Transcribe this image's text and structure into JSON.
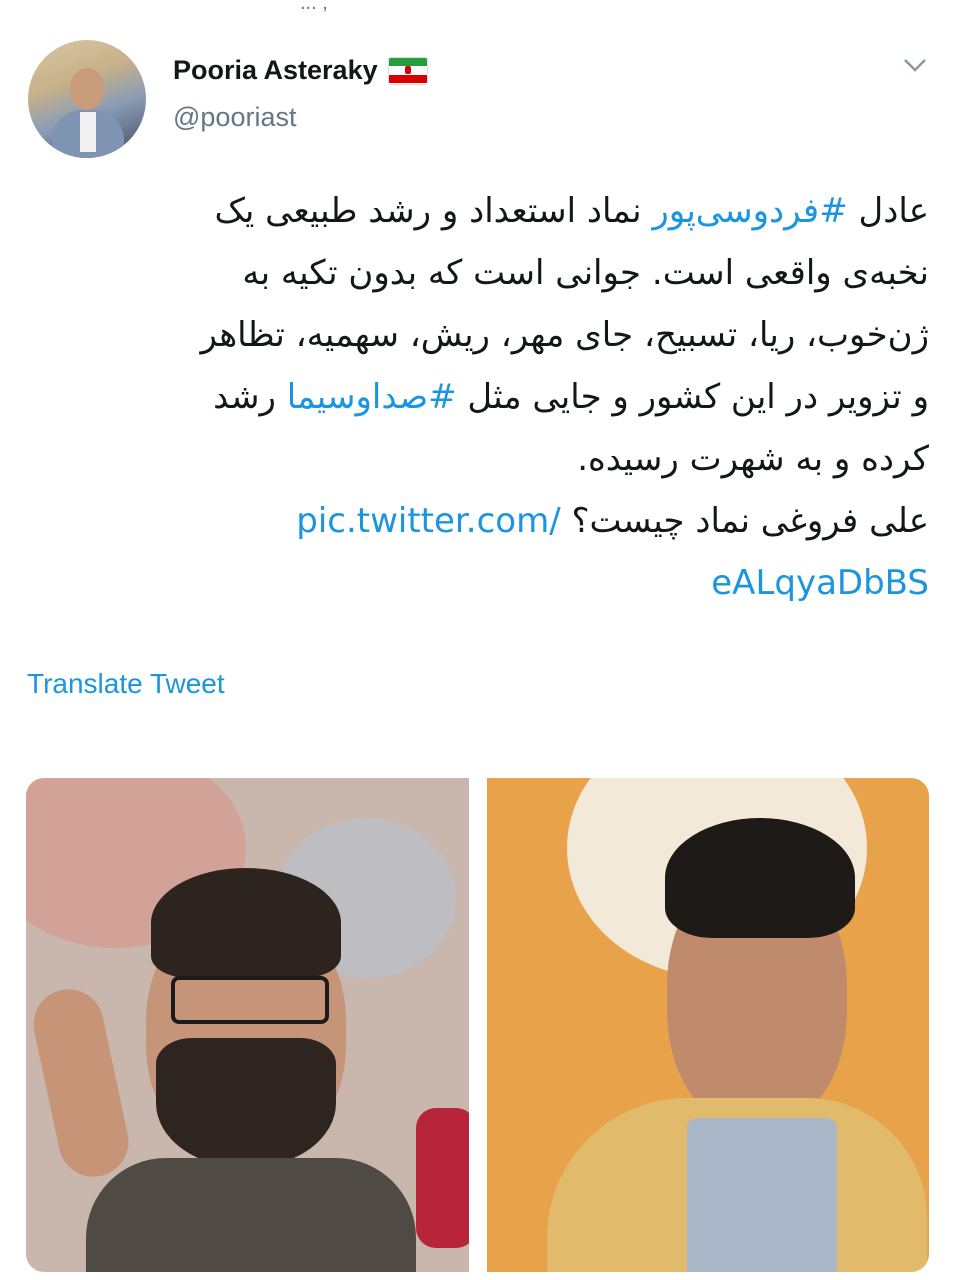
{
  "header_fragment": "... ,",
  "author": {
    "display_name": "Pooria Asteraky",
    "handle": "@pooriast",
    "flag": "iran-flag-icon"
  },
  "tweet": {
    "line1_pre": "عادل ",
    "hashtag1": "#فردوسی‌پور",
    "line1_post": " نماد استعداد و رشد طبیعی یک",
    "line2": "نخبه‌ی واقعی است. جوانی است که بدون تکیه به",
    "line3": "ژن‌خوب، ریا، تسبیح، جای مهر، ریش، سهمیه، تظاهر",
    "line4_pre": "و تزویر در این کشور و جایی مثل ",
    "hashtag2": "#صداوسیما",
    "line4_post": " رشد",
    "line5": "کرده و به شهرت رسیده.",
    "line6_text": "علی فروغی نماد چیست؟ ",
    "link_part1": "pic.twitter.com/",
    "link_part2": "eALqyaDbBS"
  },
  "translate_label": "Translate Tweet",
  "colors": {
    "link": "#1b95e0",
    "secondary": "#657786"
  }
}
